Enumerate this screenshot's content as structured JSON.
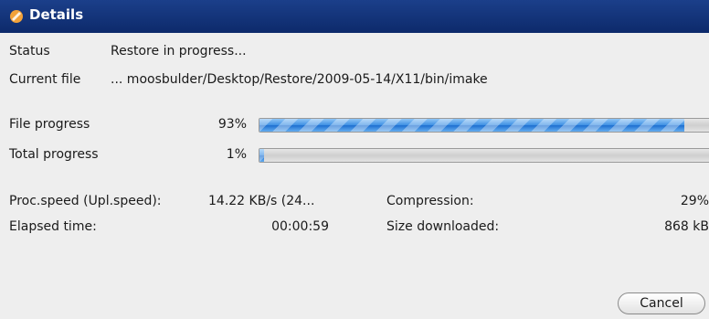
{
  "window": {
    "title": "Details",
    "icon": "app-icon"
  },
  "status": {
    "label": "Status",
    "value": "Restore in progress..."
  },
  "current_file": {
    "label": "Current file",
    "value": "... moosbulder/Desktop/Restore/2009-05-14/X11/bin/imake"
  },
  "file_progress": {
    "label": "File progress",
    "percent_text": "93%",
    "value": 0.93
  },
  "total_progress": {
    "label": "Total progress",
    "percent_text": "1%",
    "value": 0.01
  },
  "stats": {
    "proc_speed_label": "Proc.speed (Upl.speed):",
    "proc_speed_value": "14.22 KB/s (24...",
    "compression_label": "Compression:",
    "compression_value": "29%",
    "elapsed_label": "Elapsed time:",
    "elapsed_value": "00:00:59",
    "size_label": "Size downloaded:",
    "size_value": "868 kB"
  },
  "buttons": {
    "cancel": "Cancel"
  },
  "colors": {
    "title_bar": "#1b3f8a",
    "progress_fill": "#3d8fe3"
  }
}
